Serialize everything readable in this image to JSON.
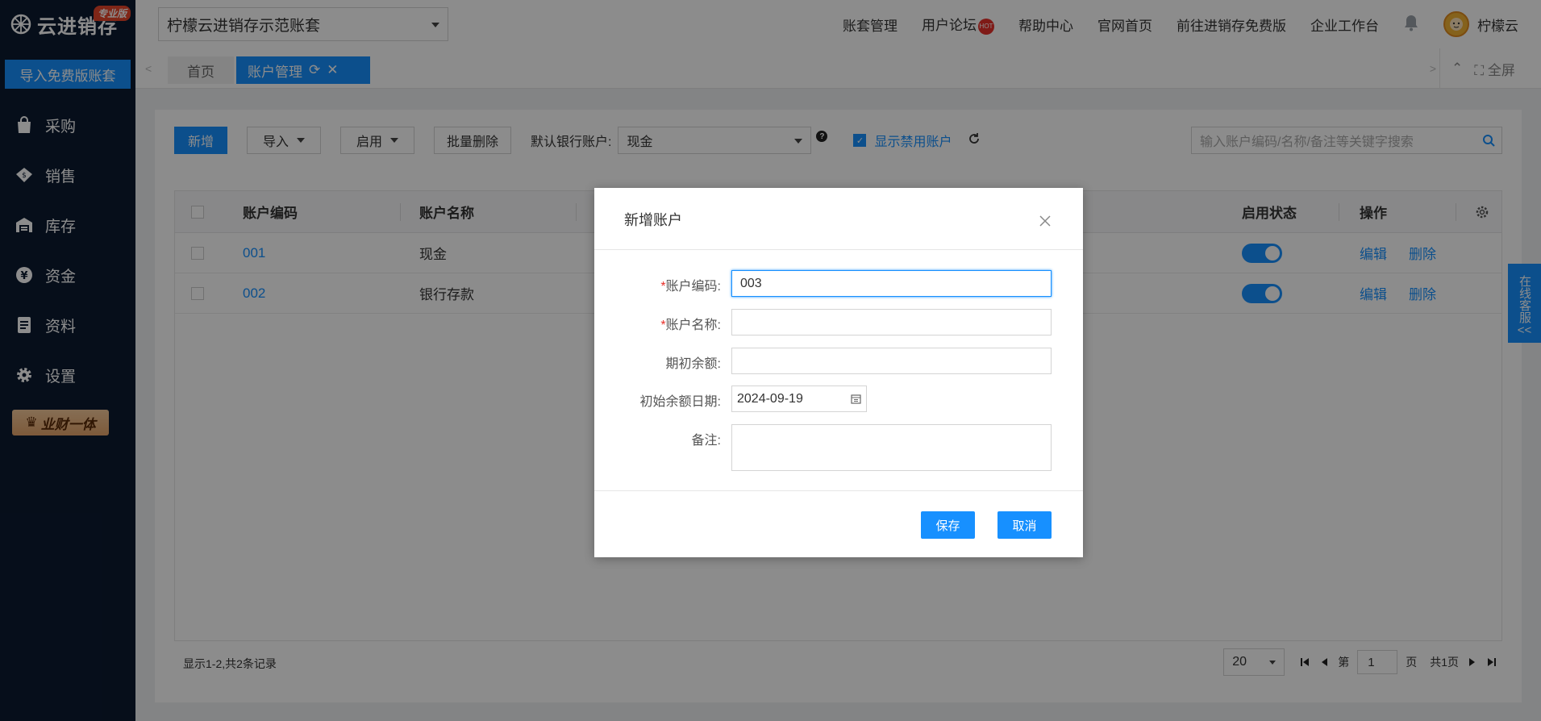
{
  "brand": {
    "name": "云进销存",
    "badge": "专业版"
  },
  "sidebar": {
    "import_button": "导入免费版账套",
    "items": [
      {
        "label": "采购",
        "icon": "bag-icon"
      },
      {
        "label": "销售",
        "icon": "sales-icon"
      },
      {
        "label": "库存",
        "icon": "warehouse-icon"
      },
      {
        "label": "资金",
        "icon": "yen-icon"
      },
      {
        "label": "资料",
        "icon": "document-icon"
      },
      {
        "label": "设置",
        "icon": "gear-icon"
      }
    ],
    "vip_label": "业财一体"
  },
  "header": {
    "account_select": "柠檬云进销存示范账套",
    "nav": [
      "账套管理",
      "用户论坛",
      "帮助中心",
      "官网首页",
      "前往进销存免费版",
      "企业工作台"
    ],
    "hot_badge": "HOT",
    "user_name": "柠檬云"
  },
  "tabs": {
    "home": "首页",
    "active": "账户管理",
    "fullscreen": "全屏"
  },
  "toolbar": {
    "add": "新增",
    "import": "导入",
    "enable": "启用",
    "batch_delete": "批量删除",
    "default_bank_label": "默认银行账户:",
    "default_bank_value": "现金",
    "show_disabled": "显示禁用账户",
    "search_placeholder": "输入账户编码/名称/备注等关键字搜索"
  },
  "table": {
    "columns": {
      "code": "账户编码",
      "name": "账户名称",
      "status": "启用状态",
      "action": "操作"
    },
    "rows": [
      {
        "code": "001",
        "name": "现金",
        "enabled": true,
        "edit": "编辑",
        "delete": "删除"
      },
      {
        "code": "002",
        "name": "银行存款",
        "enabled": true,
        "edit": "编辑",
        "delete": "删除"
      }
    ]
  },
  "footer": {
    "summary": "显示1-2,共2条记录",
    "page_size": "20",
    "page_prefix": "第",
    "page_current": "1",
    "page_suffix": "页",
    "page_total": "共1页"
  },
  "service": {
    "label": "在线客服",
    "arrow": "<<"
  },
  "modal": {
    "title": "新增账户",
    "fields": {
      "code_label": "账户编码:",
      "code_value": "003",
      "name_label": "账户名称:",
      "name_value": "",
      "balance_label": "期初余额:",
      "balance_value": "",
      "date_label": "初始余额日期:",
      "date_value": "2024-09-19",
      "remark_label": "备注:",
      "remark_value": ""
    },
    "required_mark": "*",
    "save": "保存",
    "cancel": "取消"
  },
  "colors": {
    "primary": "#1790ff",
    "sidebar": "#0b1a31",
    "required": "#e8302a"
  }
}
